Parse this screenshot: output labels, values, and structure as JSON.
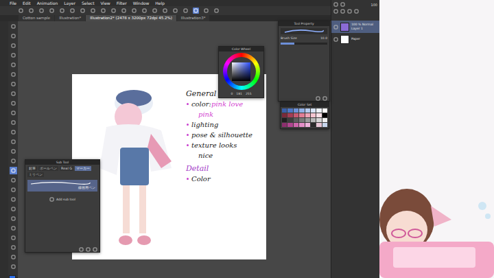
{
  "window": {
    "menu": [
      "File",
      "Edit",
      "Animation",
      "Layer",
      "Select",
      "View",
      "Filter",
      "Window",
      "Help"
    ]
  },
  "toolbar": [
    {
      "selected": false
    },
    {
      "selected": false
    },
    {
      "selected": false
    },
    {
      "selected": false
    },
    {
      "selected": false
    },
    {
      "selected": false
    },
    {
      "selected": false
    },
    {
      "selected": false
    },
    {
      "selected": false
    },
    {
      "selected": false
    },
    {
      "selected": false
    },
    {
      "selected": false
    },
    {
      "selected": false
    },
    {
      "selected": false
    },
    {
      "selected": false
    },
    {
      "selected": false
    },
    {
      "selected": false
    },
    {
      "selected": true
    },
    {
      "selected": false
    },
    {
      "selected": false
    }
  ],
  "tabs": [
    {
      "label": "Cotton sample",
      "selected": false
    },
    {
      "label": "Illustration*",
      "selected": false
    },
    {
      "label": "Illustration2* (2478 x 3200px 72dpi 45.2%)",
      "selected": true
    },
    {
      "label": "Illustration3*",
      "selected": false
    }
  ],
  "tools": [
    {
      "selected": false
    },
    {
      "selected": false
    },
    {
      "selected": false
    },
    {
      "selected": false
    },
    {
      "selected": false
    },
    {
      "selected": false
    },
    {
      "selected": false
    },
    {
      "selected": false
    },
    {
      "selected": false
    },
    {
      "selected": false
    },
    {
      "selected": false
    },
    {
      "selected": false
    },
    {
      "selected": false
    },
    {
      "selected": false
    },
    {
      "selected": false
    },
    {
      "selected": true
    },
    {
      "selected": false
    },
    {
      "selected": false
    },
    {
      "selected": false
    },
    {
      "selected": false
    },
    {
      "selected": false
    },
    {
      "selected": false
    },
    {
      "selected": false
    },
    {
      "selected": false
    },
    {
      "selected": false
    },
    {
      "selected": false
    }
  ],
  "main_color": "#2e6fe8",
  "sub_color": "#ffffff",
  "color_wheel": {
    "title": "Color Wheel",
    "values": [
      "0",
      "181",
      "255"
    ]
  },
  "tool_property": {
    "title": "Tool Property",
    "label": "Brush Size",
    "value": "10.0",
    "level": 0.3
  },
  "color_set": {
    "title": "Color Set",
    "swatches": [
      "#3a5fa8",
      "#4f77c4",
      "#6f93d8",
      "#93b1e6",
      "#b7cdf0",
      "#d7e3f7",
      "#eef3fb",
      "#ffffff",
      "#7a2a3a",
      "#a33d55",
      "#c75a73",
      "#e07e95",
      "#eea4b6",
      "#f5c5d1",
      "#fae0e7",
      "#000000",
      "#1f1f1f",
      "#3d3d3d",
      "#5c5c5c",
      "#7a7a7a",
      "#999999",
      "#b8b8b8",
      "#d6d6d6",
      "#f0f0f0",
      "#8c2f6e",
      "#b0458f",
      "#cf66ac",
      "#e48dc7",
      "#f0b3dc",
      "#2b2b2b",
      "#e8c7d6",
      "#c8d7ee"
    ]
  },
  "sub_tool": {
    "title": "Sub Tool",
    "tabs": [
      {
        "label": "鉛筆",
        "selected": false
      },
      {
        "label": "ボールペン",
        "selected": false
      },
      {
        "label": "Real G",
        "selected": false
      },
      {
        "label": "マーカー",
        "selected": true
      },
      {
        "label": "ミリペン",
        "selected": false
      }
    ],
    "items": [
      {
        "label": "線画用ペン",
        "selected": true
      }
    ],
    "add_label": "Add sub tool"
  },
  "layers": {
    "opacity": "100",
    "items": [
      {
        "blend": "100 % Normal",
        "name": "Layer 1",
        "selected": true,
        "color": "#8a6bd6"
      },
      {
        "blend": "",
        "name": "Paper",
        "selected": false,
        "color": "#ffffff"
      }
    ]
  },
  "canvas": {
    "notes": [
      {
        "kind": "heading",
        "segments": [
          {
            "text": "General",
            "color": "#1a1a1a"
          }
        ]
      },
      {
        "kind": "bullet",
        "segments": [
          {
            "text": "color: ",
            "color": "#1a1a1a"
          },
          {
            "text": "pink love",
            "color": "#d23fcf"
          }
        ]
      },
      {
        "kind": "indent",
        "segments": [
          {
            "text": "pink",
            "color": "#d23fcf"
          }
        ]
      },
      {
        "kind": "bullet",
        "segments": [
          {
            "text": "lighting",
            "color": "#1a1a1a"
          }
        ]
      },
      {
        "kind": "bullet",
        "segments": [
          {
            "text": "pose & silhouette",
            "color": "#1a1a1a"
          }
        ]
      },
      {
        "kind": "bullet",
        "segments": [
          {
            "text": "texture looks",
            "color": "#1a1a1a"
          }
        ]
      },
      {
        "kind": "indent",
        "segments": [
          {
            "text": "nice",
            "color": "#1a1a1a"
          }
        ]
      },
      {
        "kind": "heading",
        "segments": [
          {
            "text": "Detail",
            "color": "#a33cc8"
          }
        ]
      },
      {
        "kind": "bullet",
        "segments": [
          {
            "text": "Color",
            "color": "#1a1a1a"
          }
        ]
      }
    ]
  }
}
